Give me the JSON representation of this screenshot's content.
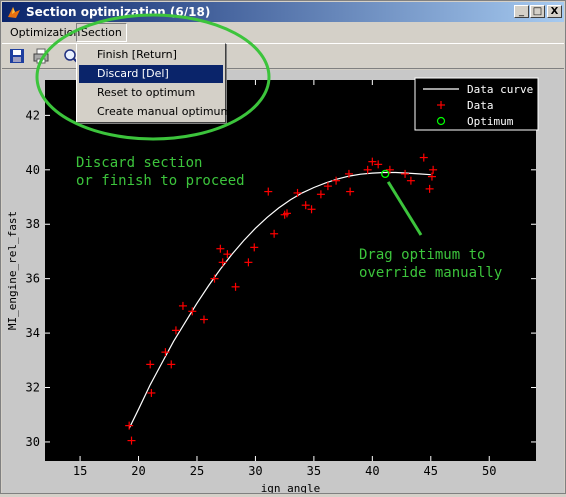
{
  "window": {
    "title": "Section optimization (6/18)",
    "buttons": [
      "_",
      "□",
      "X"
    ]
  },
  "menubar": {
    "items": [
      "Optimization",
      "Section"
    ]
  },
  "section_menu": {
    "items": [
      "Finish [Return]",
      "Discard [Del]",
      "Reset to optimum",
      "Create manual optimum"
    ],
    "selected_index": 1
  },
  "toolbar": {
    "icons": [
      "save-icon",
      "print-icon",
      "zoom-icon"
    ]
  },
  "annotations": {
    "discard_line1": "Discard section",
    "discard_line2": "or finish to proceed",
    "drag_line1": "Drag optimum to",
    "drag_line2": "override manually",
    "highlight_color": "#3cc43c"
  },
  "chart_data": {
    "type": "scatter",
    "xlabel": "ign_angle",
    "ylabel": "MI_engine_rel_fast",
    "xlim": [
      12,
      54
    ],
    "ylim": [
      29.3,
      43.3
    ],
    "xticks": [
      15,
      20,
      25,
      30,
      35,
      40,
      45,
      50
    ],
    "yticks": [
      30,
      32,
      34,
      36,
      38,
      40,
      42
    ],
    "grid": false,
    "background": "#000000",
    "legend": {
      "position": "top-right",
      "entries": [
        "Data curve",
        "Data",
        "Optimum"
      ]
    },
    "series": [
      {
        "name": "Data curve",
        "type": "line",
        "color": "#ffffff",
        "x": [
          19.2,
          20,
          21,
          22,
          23,
          24,
          25,
          26,
          27,
          28,
          29,
          30,
          31,
          32,
          33,
          34,
          35,
          36,
          37,
          38,
          39,
          40,
          41,
          42,
          43,
          44,
          45
        ],
        "y": [
          30.5,
          31.2,
          32.1,
          32.9,
          33.7,
          34.4,
          35.1,
          35.75,
          36.35,
          36.9,
          37.4,
          37.85,
          38.25,
          38.6,
          38.9,
          39.15,
          39.35,
          39.52,
          39.66,
          39.77,
          39.84,
          39.88,
          39.9,
          39.9,
          39.88,
          39.85,
          39.82
        ]
      },
      {
        "name": "Data",
        "type": "scatter",
        "marker": "+",
        "color": "#ff0000",
        "x": [
          19.2,
          19.4,
          21.0,
          21.1,
          22.3,
          22.8,
          23.2,
          23.8,
          24.6,
          25.6,
          26.5,
          27.0,
          27.2,
          27.6,
          28.3,
          29.4,
          29.9,
          31.1,
          31.6,
          32.5,
          32.7,
          33.6,
          34.3,
          34.8,
          35.6,
          36.2,
          36.9,
          38.0,
          38.1,
          39.6,
          40.0,
          40.5,
          41.5,
          42.8,
          43.3,
          44.4,
          44.9,
          45.1,
          45.2
        ],
        "y": [
          30.6,
          30.05,
          32.85,
          31.8,
          33.3,
          32.85,
          34.1,
          35.0,
          34.8,
          34.5,
          36.0,
          37.1,
          36.6,
          36.9,
          35.7,
          36.6,
          37.15,
          39.2,
          37.65,
          38.35,
          38.4,
          39.15,
          38.7,
          38.55,
          39.1,
          39.4,
          39.6,
          39.85,
          39.2,
          40.0,
          40.3,
          40.2,
          40.0,
          39.85,
          39.6,
          40.45,
          39.3,
          39.75,
          40.0
        ]
      },
      {
        "name": "Optimum",
        "type": "scatter",
        "marker": "o",
        "color": "#00ff00",
        "x": [
          41.1
        ],
        "y": [
          39.85
        ]
      }
    ]
  }
}
